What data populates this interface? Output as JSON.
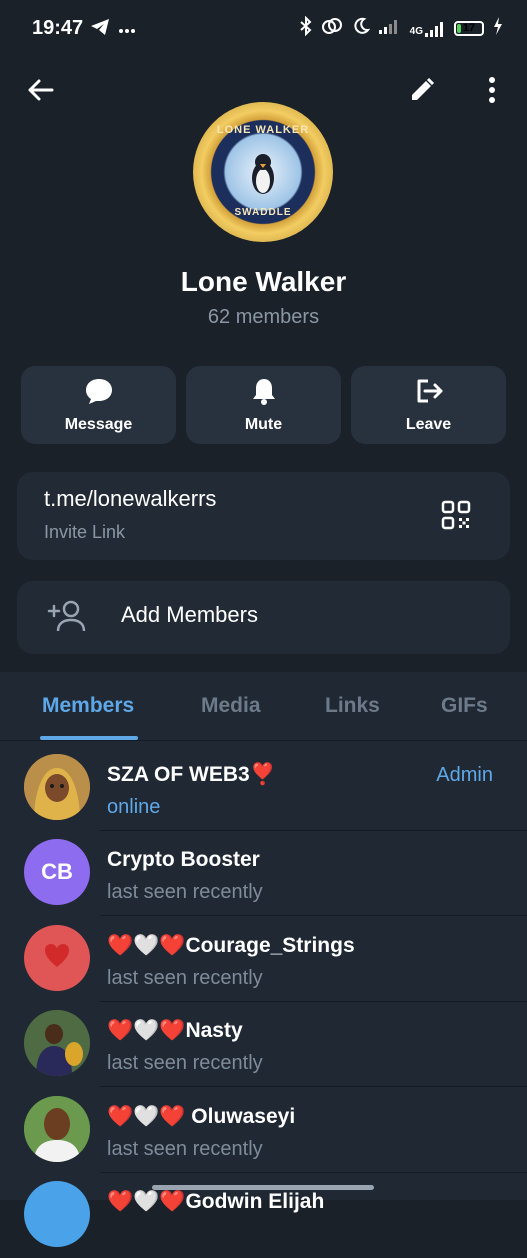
{
  "status_bar": {
    "time": "19:47",
    "icons_left": [
      "telegram-icon",
      "more-dots-icon"
    ],
    "icons_right": [
      "bluetooth-icon",
      "link-icon",
      "moon-icon",
      "signal-icon",
      "4g-signal-icon",
      "battery-icon",
      "charging-icon"
    ],
    "network": "4G",
    "battery": "17",
    "battery_level": 0.17
  },
  "topbar": {
    "back_icon": "arrow-left-icon",
    "edit_icon": "pencil-icon",
    "more_icon": "more-vertical-icon"
  },
  "group": {
    "avatar_text_top": "LONE WALKER",
    "avatar_text_bottom": "SWADDLE",
    "name": "Lone Walker",
    "members_count": "62 members"
  },
  "actions": [
    {
      "label": "Message",
      "icon": "message-bubble-icon"
    },
    {
      "label": "Mute",
      "icon": "bell-icon"
    },
    {
      "label": "Leave",
      "icon": "leave-icon"
    }
  ],
  "invite": {
    "link": "t.me/lonewalkerrs",
    "label": "Invite Link",
    "icon": "qr-code-icon"
  },
  "add_members": {
    "label": "Add Members",
    "icon": "add-user-icon"
  },
  "tabs": [
    {
      "label": "Members",
      "active": true
    },
    {
      "label": "Media",
      "active": false
    },
    {
      "label": "Links",
      "active": false
    },
    {
      "label": "GIFs",
      "active": false
    }
  ],
  "members": [
    {
      "name": "SZA OF WEB3❣️",
      "status": "online",
      "badge": "Admin",
      "avatar": "photo",
      "online": true
    },
    {
      "name": "Crypto Booster",
      "status": "last seen recently",
      "badge": "",
      "avatar": "initials",
      "initials": "CB",
      "avatar_color": "#8e6cf0"
    },
    {
      "name": "❤️🤍❤️Courage_Strings",
      "status": "last seen recently",
      "badge": "",
      "avatar": "heart",
      "avatar_color": "#e05656"
    },
    {
      "name": "❤️🤍❤️Nasty",
      "status": "last seen recently",
      "badge": "",
      "avatar": "photo"
    },
    {
      "name": "❤️🤍❤️ Oluwaseyi",
      "status": "last seen recently",
      "badge": "",
      "avatar": "photo"
    },
    {
      "name": "❤️🤍❤️Godwin Elijah",
      "status": "",
      "badge": "",
      "avatar": "initials",
      "avatar_color": "#4aa3e8"
    }
  ],
  "colors": {
    "background": "#1a2129",
    "card": "#212a35",
    "accent": "#5fa8e8",
    "muted_text": "#8b96a4"
  }
}
